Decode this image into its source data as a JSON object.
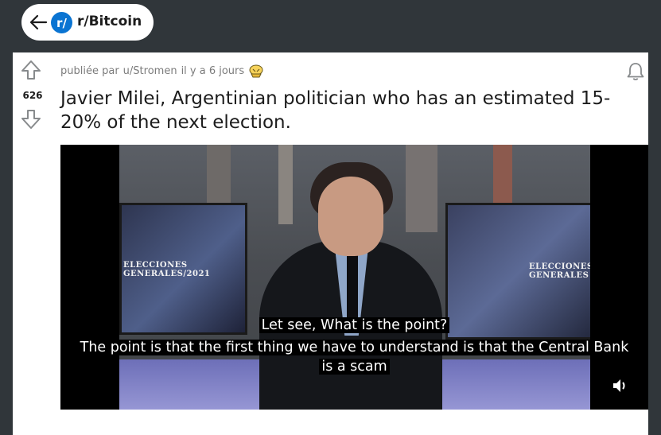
{
  "header": {
    "back_icon": "arrow-left-icon",
    "subreddit_icon_text": "r/",
    "subreddit": "r/Bitcoin"
  },
  "post": {
    "votes": "626",
    "posted_by_prefix": "publiée par",
    "author": "u/Stromen",
    "time": "il y a 6 jours",
    "title": "Javier Milei, Argentinian politician who has an estimated 15-20% of the next election.",
    "video": {
      "screen_left_text": "ELECCIONES GENERALES/2021",
      "screen_right_text": "ELECCIONES GENERALES",
      "subtitle_line1": "Let see, What is the point?",
      "subtitle_line2": "The point is that the first thing we have to understand is that the Central Bank",
      "subtitle_line3": "is a scam"
    }
  },
  "colors": {
    "page_bg": "#30363a",
    "card_bg": "#ffffff",
    "accent": "#0a74d2",
    "meta_text": "#7c7c7c"
  }
}
